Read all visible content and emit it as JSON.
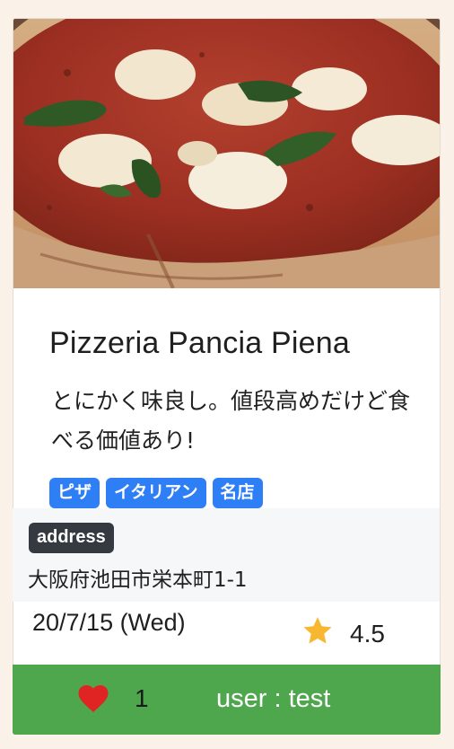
{
  "card": {
    "image_alt": "Margherita pizza photo",
    "title": "Pizzeria Pancia Piena",
    "description": "とにかく味良し。値段高めだけど食べる価値あり!",
    "tags": [
      "ピザ",
      "イタリアン",
      "名店"
    ],
    "address_label": "address",
    "address": "大阪府池田市栄本町1-1",
    "date": "20/7/15 (Wed)",
    "rating": "4.5",
    "likes": "1",
    "user": "user : test"
  },
  "colors": {
    "page_bg": "#faf1e8",
    "tag_bg": "#2e7ff5",
    "address_badge_bg": "#343a40",
    "address_box_bg": "#f6f7f9",
    "footer_bg": "#4ea64d",
    "star": "#f7b731",
    "heart": "#e02424"
  },
  "icons": {
    "star": "star-icon",
    "heart": "heart-icon"
  }
}
